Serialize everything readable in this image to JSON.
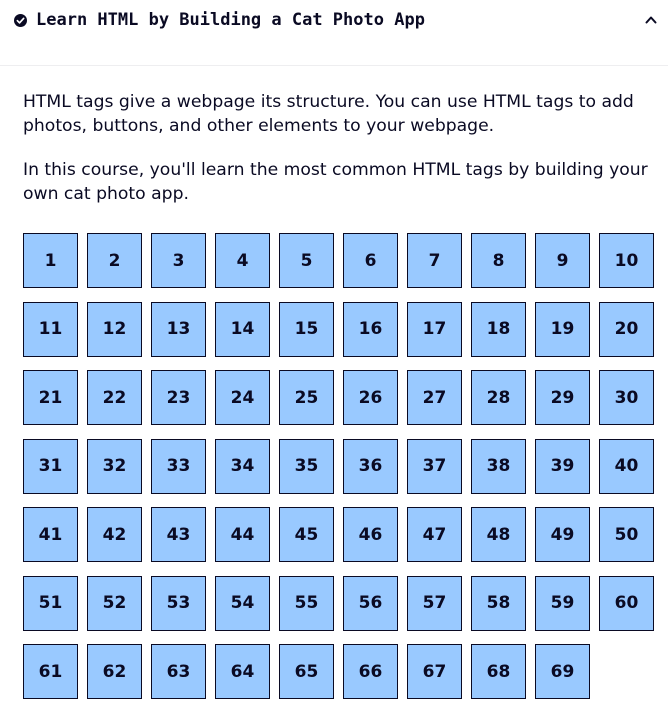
{
  "header": {
    "title": "Learn HTML by Building a Cat Photo App",
    "status_icon": "check-circle-icon",
    "toggle_icon": "chevron-up-icon"
  },
  "description": {
    "paragraph_1": "HTML tags give a webpage its structure. You can use HTML tags to add photos, buttons, and other elements to your webpage.",
    "paragraph_2": "In this course, you'll learn the most common HTML tags by building your own cat photo app."
  },
  "steps": [
    "1",
    "2",
    "3",
    "4",
    "5",
    "6",
    "7",
    "8",
    "9",
    "10",
    "11",
    "12",
    "13",
    "14",
    "15",
    "16",
    "17",
    "18",
    "19",
    "20",
    "21",
    "22",
    "23",
    "24",
    "25",
    "26",
    "27",
    "28",
    "29",
    "30",
    "31",
    "32",
    "33",
    "34",
    "35",
    "36",
    "37",
    "38",
    "39",
    "40",
    "41",
    "42",
    "43",
    "44",
    "45",
    "46",
    "47",
    "48",
    "49",
    "50",
    "51",
    "52",
    "53",
    "54",
    "55",
    "56",
    "57",
    "58",
    "59",
    "60",
    "61",
    "62",
    "63",
    "64",
    "65",
    "66",
    "67",
    "68",
    "69"
  ],
  "colors": {
    "step_fill": "#99c9ff",
    "text": "#0a0a23",
    "header_border": "#eeeef0"
  }
}
